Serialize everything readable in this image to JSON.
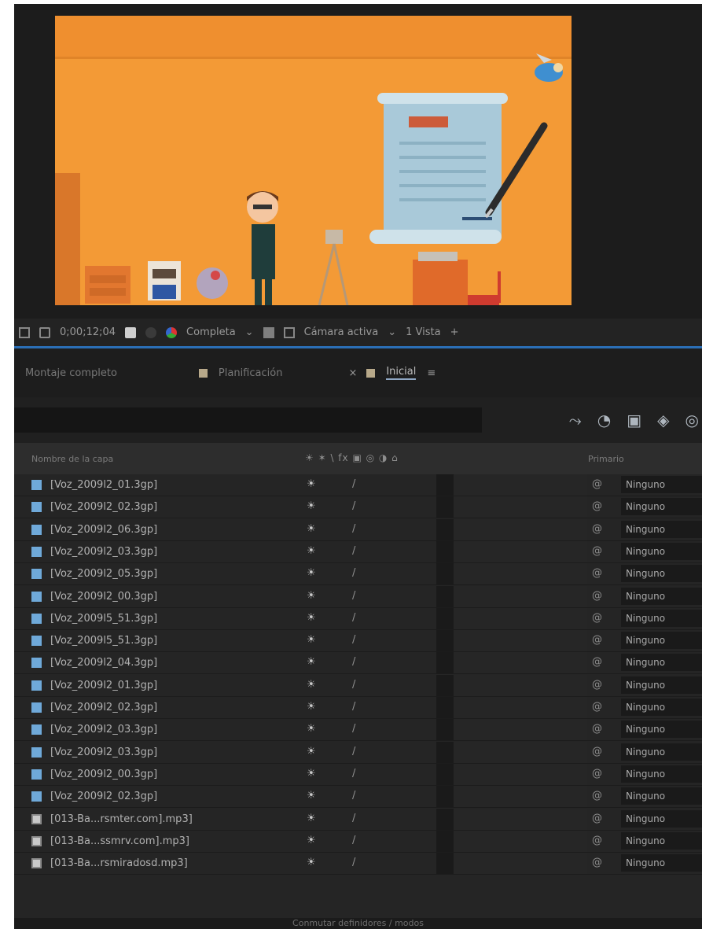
{
  "toolbar": {
    "timecode": "0;00;12;04",
    "resolution": "Completa",
    "camera": "Cámara activa",
    "views": "1 Vista"
  },
  "tabs": [
    {
      "label": "Montaje completo",
      "active": false
    },
    {
      "label": "Planificación",
      "active": false
    },
    {
      "label": "Inicial",
      "active": true
    }
  ],
  "table": {
    "header_name": "Nombre de la capa",
    "header_switches": "☀ ✶ \\ fx ▣ ◎ ◑ ⌂",
    "header_parent": "Primario",
    "rows": [
      {
        "name": "[Voz_2009l2_01.3gp]",
        "kind": "image",
        "parent": "Ninguno"
      },
      {
        "name": "[Voz_2009l2_02.3gp]",
        "kind": "image",
        "parent": "Ninguno"
      },
      {
        "name": "[Voz_2009l2_06.3gp]",
        "kind": "image",
        "parent": "Ninguno"
      },
      {
        "name": "[Voz_2009l2_03.3gp]",
        "kind": "image",
        "parent": "Ninguno"
      },
      {
        "name": "[Voz_2009l2_05.3gp]",
        "kind": "image",
        "parent": "Ninguno"
      },
      {
        "name": "[Voz_2009l2_00.3gp]",
        "kind": "image",
        "parent": "Ninguno"
      },
      {
        "name": "[Voz_2009l5_51.3gp]",
        "kind": "image",
        "parent": "Ninguno"
      },
      {
        "name": "[Voz_2009l5_51.3gp]",
        "kind": "image",
        "parent": "Ninguno"
      },
      {
        "name": "[Voz_2009l2_04.3gp]",
        "kind": "image",
        "parent": "Ninguno"
      },
      {
        "name": "[Voz_2009l2_01.3gp]",
        "kind": "image",
        "parent": "Ninguno"
      },
      {
        "name": "[Voz_2009l2_02.3gp]",
        "kind": "image",
        "parent": "Ninguno"
      },
      {
        "name": "[Voz_2009l2_03.3gp]",
        "kind": "image",
        "parent": "Ninguno"
      },
      {
        "name": "[Voz_2009l2_03.3gp]",
        "kind": "image",
        "parent": "Ninguno"
      },
      {
        "name": "[Voz_2009l2_00.3gp]",
        "kind": "image",
        "parent": "Ninguno"
      },
      {
        "name": "[Voz_2009l2_02.3gp]",
        "kind": "image",
        "parent": "Ninguno"
      },
      {
        "name": "[013-Ba...rsmter.com].mp3]",
        "kind": "audio",
        "parent": "Ninguno"
      },
      {
        "name": "[013-Ba...ssmrv.com].mp3]",
        "kind": "audio",
        "parent": "Ninguno"
      },
      {
        "name": "[013-Ba...rsmiradosd.mp3]",
        "kind": "audio",
        "parent": "Ninguno"
      }
    ]
  },
  "status": "Conmutar definidores / modos",
  "icons": {
    "row_visibility": "eye-icon",
    "row_quality": "check-icon",
    "row_parent_pickwhip": "spiral-icon"
  },
  "colors": {
    "accent": "#2b6fb6",
    "canvas_bg": "#f39a36",
    "image_layer": "#6fa9d9"
  }
}
